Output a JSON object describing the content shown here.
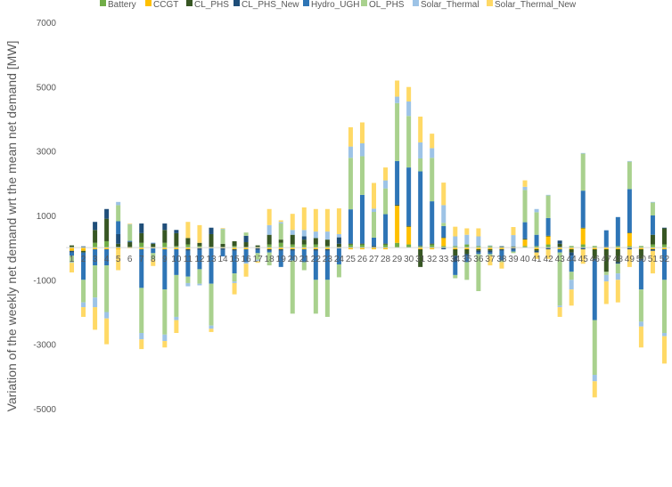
{
  "chart_data": {
    "type": "bar",
    "stacked": true,
    "ylabel": "Variation of the weekly net demand wrt the mean net demand [MW]",
    "ylim": [
      -5000,
      7000
    ],
    "yticks": [
      -5000,
      -3000,
      -1000,
      1000,
      3000,
      5000,
      7000
    ],
    "grid": false,
    "legend_position": "top",
    "categories": [
      "1",
      "2",
      "3",
      "4",
      "5",
      "6",
      "7",
      "8",
      "9",
      "10",
      "11",
      "12",
      "13",
      "14",
      "15",
      "16",
      "17",
      "18",
      "19",
      "20",
      "21",
      "22",
      "23",
      "24",
      "25",
      "26",
      "27",
      "28",
      "29",
      "30",
      "31",
      "32",
      "33",
      "34",
      "35",
      "36",
      "37",
      "38",
      "39",
      "40",
      "41",
      "42",
      "43",
      "44",
      "45",
      "46",
      "47",
      "48",
      "49",
      "50",
      "51",
      "52"
    ],
    "colors": {
      "Battery": "#70ad47",
      "CCGT": "#ffc000",
      "CL_PHS": "#375623",
      "CL_PHS_New": "#1f4e79",
      "Hydro_UGH": "#2e75b6",
      "OL_PHS": "#a9d18e",
      "Solar_Thermal": "#9dc3e6",
      "Solar_Thermal_New": "#ffd966"
    },
    "series": [
      {
        "name": "Battery",
        "values": [
          20,
          20,
          150,
          200,
          20,
          20,
          150,
          20,
          150,
          50,
          100,
          50,
          20,
          20,
          50,
          20,
          20,
          100,
          150,
          100,
          100,
          100,
          50,
          20,
          100,
          100,
          20,
          100,
          150,
          100,
          50,
          100,
          50,
          50,
          100,
          50,
          50,
          20,
          20,
          50,
          50,
          100,
          20,
          50,
          100,
          50,
          20,
          50,
          50,
          50,
          100,
          100
        ]
      },
      {
        "name": "CCGT",
        "values": [
          -100,
          -100,
          -50,
          -50,
          -50,
          -20,
          -50,
          -20,
          -50,
          -50,
          -50,
          -20,
          -20,
          -20,
          -50,
          -50,
          -20,
          -50,
          -50,
          -50,
          -50,
          -50,
          -50,
          -20,
          -50,
          -50,
          -50,
          -50,
          1150,
          550,
          -50,
          -50,
          250,
          -50,
          -50,
          -50,
          -50,
          -50,
          -20,
          200,
          -50,
          250,
          -50,
          -50,
          500,
          -50,
          -50,
          -50,
          400,
          -50,
          -50,
          -50
        ]
      },
      {
        "name": "CL_PHS",
        "values": [
          50,
          -50,
          400,
          700,
          100,
          150,
          300,
          100,
          400,
          400,
          200,
          100,
          400,
          100,
          150,
          150,
          50,
          300,
          100,
          300,
          150,
          200,
          200,
          100,
          20,
          20,
          20,
          20,
          20,
          20,
          -550,
          20,
          20,
          -200,
          -150,
          -50,
          -50,
          20,
          20,
          20,
          -50,
          20,
          100,
          -100,
          20,
          -300,
          -700,
          -400,
          20,
          -300,
          300,
          500
        ]
      },
      {
        "name": "CL_PHS_New",
        "values": [
          -50,
          20,
          250,
          300,
          300,
          20,
          300,
          20,
          200,
          100,
          -50,
          -50,
          200,
          -50,
          -50,
          200,
          -50,
          -50,
          -50,
          -50,
          100,
          -50,
          -50,
          200,
          20,
          20,
          20,
          20,
          20,
          20,
          20,
          20,
          -50,
          -200,
          -50,
          -50,
          -50,
          -50,
          -50,
          20,
          -50,
          -50,
          100,
          -100,
          -50,
          -50,
          20,
          -50,
          -50,
          -50,
          -50,
          20
        ]
      },
      {
        "name": "Hydro_UGH",
        "values": [
          -100,
          -850,
          -500,
          -500,
          400,
          20,
          -1200,
          -150,
          -1250,
          -800,
          -800,
          -600,
          -1100,
          -200,
          -700,
          -400,
          -100,
          -50,
          -500,
          -300,
          -400,
          -900,
          -900,
          -500,
          1050,
          1500,
          250,
          900,
          1350,
          1800,
          2300,
          1300,
          350,
          -400,
          -200,
          -50,
          -50,
          -300,
          -50,
          500,
          350,
          550,
          -100,
          -500,
          1150,
          -1850,
          500,
          900,
          1350,
          -900,
          600,
          -950
        ]
      },
      {
        "name": "OL_PHS",
        "values": [
          -200,
          -700,
          -1000,
          -1450,
          500,
          500,
          -1400,
          -200,
          -1400,
          -1300,
          -200,
          -450,
          -1300,
          450,
          -250,
          100,
          -200,
          -400,
          500,
          -1650,
          -250,
          -1050,
          -1150,
          -400,
          1600,
          1200,
          800,
          800,
          1800,
          1600,
          400,
          1350,
          100,
          -100,
          -550,
          -1150,
          -50,
          -50,
          -50,
          1000,
          700,
          700,
          -1650,
          -250,
          1150,
          -1700,
          -100,
          -300,
          850,
          -1000,
          400,
          -1650
        ]
      },
      {
        "name": "Solar_Thermal",
        "values": [
          -20,
          -150,
          -300,
          -200,
          100,
          20,
          -200,
          20,
          -200,
          -100,
          -100,
          -50,
          -100,
          20,
          -50,
          -50,
          -50,
          300,
          50,
          150,
          200,
          200,
          250,
          100,
          350,
          400,
          100,
          250,
          200,
          450,
          500,
          300,
          550,
          300,
          300,
          300,
          20,
          20,
          350,
          100,
          100,
          20,
          -50,
          -300,
          20,
          -200,
          -200,
          -200,
          20,
          -150,
          20,
          -100
        ]
      },
      {
        "name": "Solar_Thermal_New",
        "values": [
          -300,
          -300,
          -700,
          -800,
          -650,
          20,
          -300,
          -200,
          -200,
          -400,
          500,
          550,
          -100,
          20,
          -350,
          -400,
          -50,
          500,
          50,
          500,
          700,
          700,
          700,
          800,
          600,
          650,
          800,
          400,
          500,
          450,
          800,
          450,
          700,
          300,
          200,
          250,
          -300,
          -200,
          250,
          200,
          -200,
          -300,
          -300,
          -500,
          -450,
          -500,
          -700,
          -700,
          -550,
          -650,
          -700,
          -850
        ]
      }
    ]
  }
}
